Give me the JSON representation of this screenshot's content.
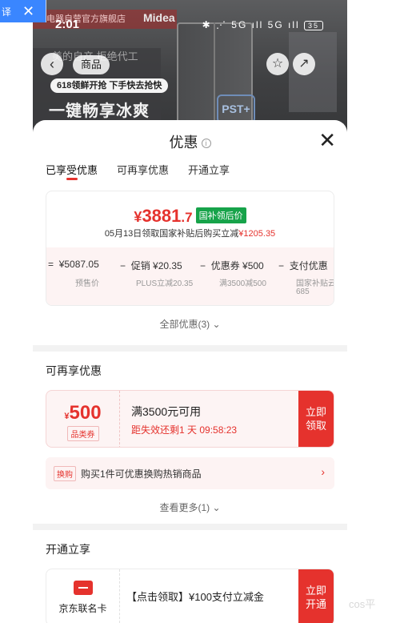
{
  "overlay": {
    "chip_text": "译",
    "close_label": "✕"
  },
  "status_bar": {
    "time": "2:01",
    "icons": "✱ ⋰ 5G ıll 5G ıll",
    "battery": "35"
  },
  "hero": {
    "shop_banner": "东电器自营官方旗舰店",
    "brand": "Midea",
    "subline": "美的自产 拒绝代工",
    "badge": "618领鲜开抢 下手快去抢快",
    "headline": "一键畅享冰爽",
    "pst": "PST+"
  },
  "nav": {
    "back_icon": "‹",
    "tab_label": "商品",
    "star_icon": "☆",
    "share_icon": "↗"
  },
  "sheet": {
    "title": "优惠",
    "info_icon": "i",
    "close_icon": "✕",
    "tabs": [
      {
        "label": "已享受优惠",
        "active": true
      },
      {
        "label": "可再享优惠",
        "active": false
      },
      {
        "label": "开通立享",
        "active": false
      }
    ],
    "price": {
      "symbol": "¥",
      "amount": "3881",
      "decimal": ".7",
      "tag": "国补领后价",
      "subtitle": "05月13日领取国家补贴后购买立减",
      "subtitle_amount": "¥1205.35"
    },
    "formula": [
      {
        "op": "=",
        "value": "¥5087.05",
        "label": "预售价"
      },
      {
        "op": "−",
        "value": "促销 ¥20.35",
        "label": "PLUS立减20.35"
      },
      {
        "op": "−",
        "value": "优惠券 ¥500",
        "label": "满3500减500"
      },
      {
        "op": "−",
        "value": "支付优惠",
        "label": "国家补贴云",
        "label2": "685"
      }
    ],
    "all_promos": "全部优惠(3)",
    "reenjoy": {
      "title": "可再享优惠",
      "coupon": {
        "symbol": "¥",
        "amount": "500",
        "type": "品类券",
        "condition": "满3500元可用",
        "expiry": "距失效还剩1 天 09:58:23",
        "button_line1": "立即",
        "button_line2": "领取"
      },
      "swap": {
        "tag": "换购",
        "text": "购买1件可优惠换购热销商品",
        "arrow": "›"
      },
      "more": "查看更多(1)"
    },
    "open": {
      "title": "开通立享",
      "card_name": "京东联名卡",
      "offer": "【点击领取】¥100支付立减金",
      "button_line1": "立即",
      "button_line2": "开通"
    }
  },
  "watermark": "cos平"
}
